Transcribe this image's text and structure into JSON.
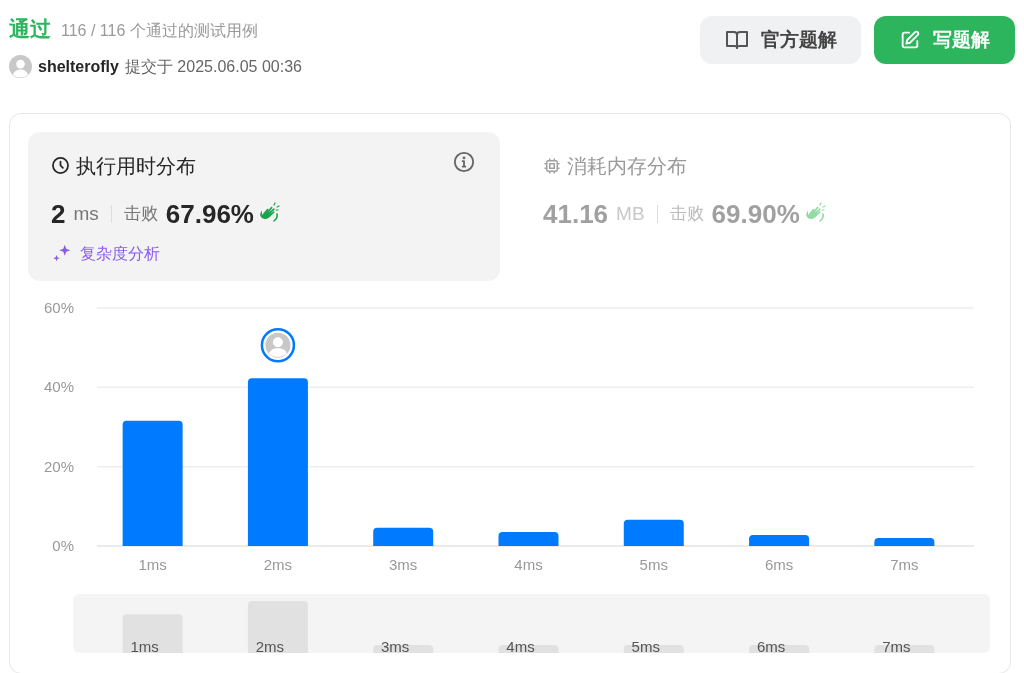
{
  "header": {
    "status": "通过",
    "tests": "116 / 116 个通过的测试用例",
    "user": "shelterofly",
    "submitted": "提交于 2025.06.05 00:36"
  },
  "buttons": [
    {
      "label": "官方题解",
      "kind": "secondary"
    },
    {
      "label": "写题解",
      "kind": "primary"
    }
  ],
  "panels": [
    {
      "kind": "runtime",
      "title": "执行用时分布",
      "value_number": "2",
      "unit": "ms",
      "beats_label": "击败",
      "beats": "67.96%",
      "selected": true,
      "link": "复杂度分析"
    },
    {
      "kind": "memory",
      "title": "消耗内存分布",
      "value_number": "41.16",
      "unit": "MB",
      "beats_label": "击败",
      "beats": "69.90%",
      "selected": false
    }
  ],
  "chart_data": {
    "type": "bar",
    "categories": [
      "1ms",
      "2ms",
      "3ms",
      "4ms",
      "5ms",
      "6ms",
      "7ms"
    ],
    "series": [
      {
        "color": "#007aff",
        "values": [
          31.6,
          42.3,
          4.6,
          3.5,
          6.6,
          2.8,
          2.0
        ]
      }
    ],
    "ylim": [
      0,
      60
    ],
    "yticks": [
      {
        "value": 0,
        "label": "0%"
      },
      {
        "value": 20,
        "label": "20%"
      },
      {
        "value": 40,
        "label": "40%"
      },
      {
        "value": 60,
        "label": "60%"
      }
    ],
    "annotations": [
      {
        "x": "2ms"
      }
    ]
  },
  "navigator": {
    "labels": [
      "1ms",
      "2ms",
      "3ms",
      "4ms",
      "5ms",
      "6ms",
      "7ms"
    ]
  }
}
